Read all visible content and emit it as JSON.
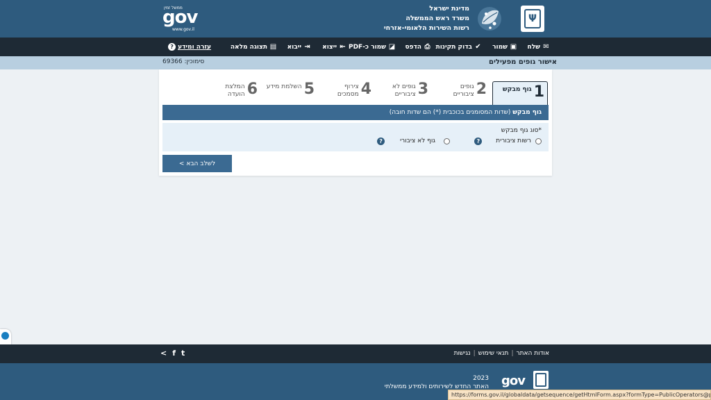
{
  "header": {
    "ministry_lines": [
      "מדינת ישראל",
      "משרד ראש הממשלה",
      "רשות השירות הלאומי-אזרחי"
    ],
    "gov_logo": "gov",
    "gov_logo_small": "ממשל זמין",
    "gov_url": "www.gov.il",
    "emblem_icon": "menorah-emblem-icon",
    "leaf_logo_icon": "national-service-leaf-logo"
  },
  "toolbar": {
    "send": "שלח",
    "save": "שמור",
    "validate": "בדוק תקינות",
    "print": "הדפס",
    "save_pdf": "שמור כ-PDF",
    "export": "ייצוא",
    "import": "ייבוא",
    "full_view": "תצוגה מלאה",
    "help": "עזרה ומידע",
    "help_icon_glyph": "?"
  },
  "titlebar": {
    "page_title": "אישור גופים מפעילים",
    "reference": "סימוכין: 69366"
  },
  "steps": [
    {
      "num": "1",
      "label1": "גוף מבקש",
      "label2": ""
    },
    {
      "num": "2",
      "label1": "גופים",
      "label2": "ציבוריים"
    },
    {
      "num": "3",
      "label1": "גופים לא",
      "label2": "ציבוריים"
    },
    {
      "num": "4",
      "label1": "צירוף",
      "label2": "מסמכים"
    },
    {
      "num": "5",
      "label1": "השלמת מידע",
      "label2": ""
    },
    {
      "num": "6",
      "label1": "המלצת",
      "label2": "הועדה"
    }
  ],
  "section": {
    "title": "גוף מבקש",
    "note": "(שדות המסומנים בכוכבית (*) הם שדות חובה)",
    "field_label": "*סוג גוף מבקש",
    "options": [
      "רשות ציבורית",
      "גוף לא ציבורי"
    ],
    "help_glyph": "?"
  },
  "next_button": "לשלב הבא >",
  "footer": {
    "links": [
      "אודות האתר",
      "תנאי שימוש",
      "נגישות"
    ],
    "separator": "|",
    "social_share": "<",
    "social_facebook": "f",
    "social_twitter": "t",
    "year": "2023",
    "site_desc": "האתר החדש לשירותים ולמידע ממשלתי",
    "gov_logo": "gov"
  },
  "status_url": "https://forms.gov.il/globaldata/getsequence/getHtmlForm.aspx?formType=PublicOperators@pmo.gov.il#",
  "colors": {
    "header": "#2e5b7e",
    "toolbar": "#1e2a35",
    "titlebar": "#b8cfe0",
    "section_head": "#3b6a92",
    "section_body": "#e6f0f8",
    "status_bar": "#f8e3c5"
  }
}
